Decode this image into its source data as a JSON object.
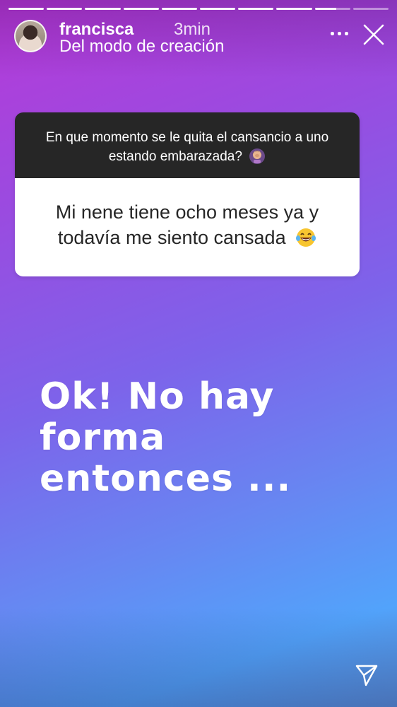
{
  "story": {
    "progress_segments": 10,
    "progress_completed": 8,
    "progress_current_fraction": 0.6
  },
  "header": {
    "username": "francisca",
    "time": "3min",
    "subtitle": "Del modo de creación",
    "avatar_icon": "profile-photo",
    "more_icon": "more-horizontal-icon",
    "close_icon": "close-icon"
  },
  "question_sticker": {
    "question": "En que momento se le quita el cansancio a uno estando embarazada?",
    "question_emoji": "woman-facepalming-emoji",
    "answer": "Mi nene tiene ocho meses ya y todavía me siento cansada",
    "answer_emoji": "tears-of-joy-emoji"
  },
  "overlay": {
    "line1": "Ok! No hay forma",
    "line2": "entonces ..."
  },
  "footer": {
    "share_icon": "send-icon"
  },
  "colors": {
    "gradient_top": "#b63ad8",
    "gradient_bottom": "#52a3fb",
    "question_header_bg": "#262626",
    "answer_bg": "#ffffff"
  }
}
